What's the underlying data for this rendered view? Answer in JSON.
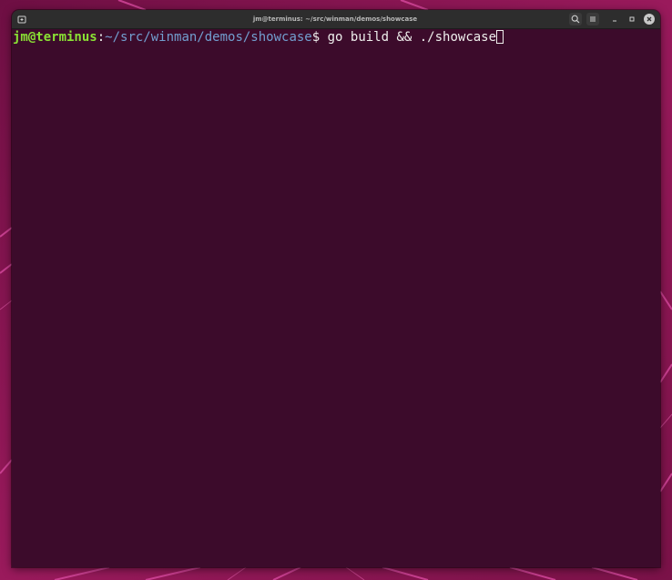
{
  "window": {
    "title": "jm@terminus: ~/src/winman/demos/showcase"
  },
  "terminal": {
    "prompt_user": "jm@terminus",
    "prompt_separator": ":",
    "prompt_path": "~/src/winman/demos/showcase",
    "prompt_symbol": "$",
    "command": " go build && ./showcase"
  },
  "icons": {
    "new_tab": "new-tab-icon",
    "search": "search-icon",
    "menu": "hamburger-menu-icon",
    "minimize": "minimize-icon",
    "maximize": "maximize-icon",
    "close": "close-icon"
  },
  "colors": {
    "terminal_background": "#3c0b2b",
    "titlebar_background": "#2d2d2d",
    "prompt_user": "#8ae234",
    "prompt_path": "#729fcf",
    "text": "#eeeeec",
    "wallpaper": "#8a1552"
  }
}
